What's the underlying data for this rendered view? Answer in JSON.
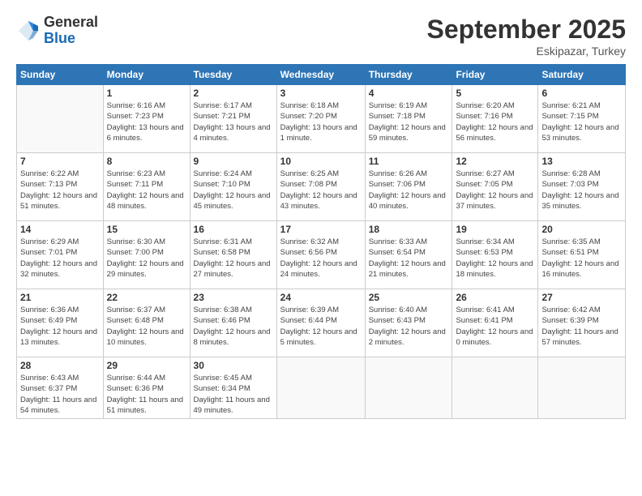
{
  "logo": {
    "general": "General",
    "blue": "Blue"
  },
  "header": {
    "month": "September 2025",
    "location": "Eskipazar, Turkey"
  },
  "weekdays": [
    "Sunday",
    "Monday",
    "Tuesday",
    "Wednesday",
    "Thursday",
    "Friday",
    "Saturday"
  ],
  "rows": [
    [
      {
        "day": "",
        "sunrise": "",
        "sunset": "",
        "daylight": ""
      },
      {
        "day": "1",
        "sunrise": "Sunrise: 6:16 AM",
        "sunset": "Sunset: 7:23 PM",
        "daylight": "Daylight: 13 hours and 6 minutes."
      },
      {
        "day": "2",
        "sunrise": "Sunrise: 6:17 AM",
        "sunset": "Sunset: 7:21 PM",
        "daylight": "Daylight: 13 hours and 4 minutes."
      },
      {
        "day": "3",
        "sunrise": "Sunrise: 6:18 AM",
        "sunset": "Sunset: 7:20 PM",
        "daylight": "Daylight: 13 hours and 1 minute."
      },
      {
        "day": "4",
        "sunrise": "Sunrise: 6:19 AM",
        "sunset": "Sunset: 7:18 PM",
        "daylight": "Daylight: 12 hours and 59 minutes."
      },
      {
        "day": "5",
        "sunrise": "Sunrise: 6:20 AM",
        "sunset": "Sunset: 7:16 PM",
        "daylight": "Daylight: 12 hours and 56 minutes."
      },
      {
        "day": "6",
        "sunrise": "Sunrise: 6:21 AM",
        "sunset": "Sunset: 7:15 PM",
        "daylight": "Daylight: 12 hours and 53 minutes."
      }
    ],
    [
      {
        "day": "7",
        "sunrise": "Sunrise: 6:22 AM",
        "sunset": "Sunset: 7:13 PM",
        "daylight": "Daylight: 12 hours and 51 minutes."
      },
      {
        "day": "8",
        "sunrise": "Sunrise: 6:23 AM",
        "sunset": "Sunset: 7:11 PM",
        "daylight": "Daylight: 12 hours and 48 minutes."
      },
      {
        "day": "9",
        "sunrise": "Sunrise: 6:24 AM",
        "sunset": "Sunset: 7:10 PM",
        "daylight": "Daylight: 12 hours and 45 minutes."
      },
      {
        "day": "10",
        "sunrise": "Sunrise: 6:25 AM",
        "sunset": "Sunset: 7:08 PM",
        "daylight": "Daylight: 12 hours and 43 minutes."
      },
      {
        "day": "11",
        "sunrise": "Sunrise: 6:26 AM",
        "sunset": "Sunset: 7:06 PM",
        "daylight": "Daylight: 12 hours and 40 minutes."
      },
      {
        "day": "12",
        "sunrise": "Sunrise: 6:27 AM",
        "sunset": "Sunset: 7:05 PM",
        "daylight": "Daylight: 12 hours and 37 minutes."
      },
      {
        "day": "13",
        "sunrise": "Sunrise: 6:28 AM",
        "sunset": "Sunset: 7:03 PM",
        "daylight": "Daylight: 12 hours and 35 minutes."
      }
    ],
    [
      {
        "day": "14",
        "sunrise": "Sunrise: 6:29 AM",
        "sunset": "Sunset: 7:01 PM",
        "daylight": "Daylight: 12 hours and 32 minutes."
      },
      {
        "day": "15",
        "sunrise": "Sunrise: 6:30 AM",
        "sunset": "Sunset: 7:00 PM",
        "daylight": "Daylight: 12 hours and 29 minutes."
      },
      {
        "day": "16",
        "sunrise": "Sunrise: 6:31 AM",
        "sunset": "Sunset: 6:58 PM",
        "daylight": "Daylight: 12 hours and 27 minutes."
      },
      {
        "day": "17",
        "sunrise": "Sunrise: 6:32 AM",
        "sunset": "Sunset: 6:56 PM",
        "daylight": "Daylight: 12 hours and 24 minutes."
      },
      {
        "day": "18",
        "sunrise": "Sunrise: 6:33 AM",
        "sunset": "Sunset: 6:54 PM",
        "daylight": "Daylight: 12 hours and 21 minutes."
      },
      {
        "day": "19",
        "sunrise": "Sunrise: 6:34 AM",
        "sunset": "Sunset: 6:53 PM",
        "daylight": "Daylight: 12 hours and 18 minutes."
      },
      {
        "day": "20",
        "sunrise": "Sunrise: 6:35 AM",
        "sunset": "Sunset: 6:51 PM",
        "daylight": "Daylight: 12 hours and 16 minutes."
      }
    ],
    [
      {
        "day": "21",
        "sunrise": "Sunrise: 6:36 AM",
        "sunset": "Sunset: 6:49 PM",
        "daylight": "Daylight: 12 hours and 13 minutes."
      },
      {
        "day": "22",
        "sunrise": "Sunrise: 6:37 AM",
        "sunset": "Sunset: 6:48 PM",
        "daylight": "Daylight: 12 hours and 10 minutes."
      },
      {
        "day": "23",
        "sunrise": "Sunrise: 6:38 AM",
        "sunset": "Sunset: 6:46 PM",
        "daylight": "Daylight: 12 hours and 8 minutes."
      },
      {
        "day": "24",
        "sunrise": "Sunrise: 6:39 AM",
        "sunset": "Sunset: 6:44 PM",
        "daylight": "Daylight: 12 hours and 5 minutes."
      },
      {
        "day": "25",
        "sunrise": "Sunrise: 6:40 AM",
        "sunset": "Sunset: 6:43 PM",
        "daylight": "Daylight: 12 hours and 2 minutes."
      },
      {
        "day": "26",
        "sunrise": "Sunrise: 6:41 AM",
        "sunset": "Sunset: 6:41 PM",
        "daylight": "Daylight: 12 hours and 0 minutes."
      },
      {
        "day": "27",
        "sunrise": "Sunrise: 6:42 AM",
        "sunset": "Sunset: 6:39 PM",
        "daylight": "Daylight: 11 hours and 57 minutes."
      }
    ],
    [
      {
        "day": "28",
        "sunrise": "Sunrise: 6:43 AM",
        "sunset": "Sunset: 6:37 PM",
        "daylight": "Daylight: 11 hours and 54 minutes."
      },
      {
        "day": "29",
        "sunrise": "Sunrise: 6:44 AM",
        "sunset": "Sunset: 6:36 PM",
        "daylight": "Daylight: 11 hours and 51 minutes."
      },
      {
        "day": "30",
        "sunrise": "Sunrise: 6:45 AM",
        "sunset": "Sunset: 6:34 PM",
        "daylight": "Daylight: 11 hours and 49 minutes."
      },
      {
        "day": "",
        "sunrise": "",
        "sunset": "",
        "daylight": ""
      },
      {
        "day": "",
        "sunrise": "",
        "sunset": "",
        "daylight": ""
      },
      {
        "day": "",
        "sunrise": "",
        "sunset": "",
        "daylight": ""
      },
      {
        "day": "",
        "sunrise": "",
        "sunset": "",
        "daylight": ""
      }
    ]
  ]
}
